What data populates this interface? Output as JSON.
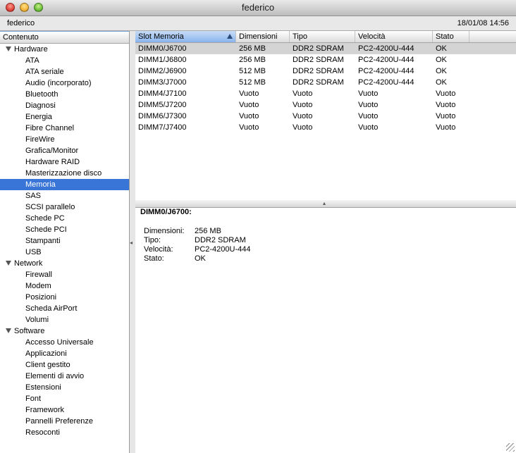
{
  "window": {
    "title": "federico"
  },
  "infobar": {
    "computer_name": "federico",
    "datetime": "18/01/08 14:56"
  },
  "sidebar": {
    "header": "Contenuto",
    "groups": [
      {
        "label": "Hardware",
        "items": [
          "ATA",
          "ATA seriale",
          "Audio (incorporato)",
          "Bluetooth",
          "Diagnosi",
          "Energia",
          "Fibre Channel",
          "FireWire",
          "Grafica/Monitor",
          "Hardware RAID",
          "Masterizzazione disco",
          "Memoria",
          "SAS",
          "SCSI parallelo",
          "Schede PC",
          "Schede PCI",
          "Stampanti",
          "USB"
        ]
      },
      {
        "label": "Network",
        "items": [
          "Firewall",
          "Modem",
          "Posizioni",
          "Scheda AirPort",
          "Volumi"
        ]
      },
      {
        "label": "Software",
        "items": [
          "Accesso Universale",
          "Applicazioni",
          "Client gestito",
          "Elementi di avvio",
          "Estensioni",
          "Font",
          "Framework",
          "Pannelli Preferenze",
          "Resoconti"
        ]
      }
    ],
    "selected": "Memoria"
  },
  "table": {
    "columns": [
      "Slot Memoria",
      "Dimensioni",
      "Tipo",
      "Velocità",
      "Stato",
      ""
    ],
    "rows": [
      [
        "DIMM0/J6700",
        "256 MB",
        "DDR2 SDRAM",
        "PC2-4200U-444",
        "OK"
      ],
      [
        "DIMM1/J6800",
        "256 MB",
        "DDR2 SDRAM",
        "PC2-4200U-444",
        "OK"
      ],
      [
        "DIMM2/J6900",
        "512 MB",
        "DDR2 SDRAM",
        "PC2-4200U-444",
        "OK"
      ],
      [
        "DIMM3/J7000",
        "512 MB",
        "DDR2 SDRAM",
        "PC2-4200U-444",
        "OK"
      ],
      [
        "DIMM4/J7100",
        "Vuoto",
        "Vuoto",
        "Vuoto",
        "Vuoto"
      ],
      [
        "DIMM5/J7200",
        "Vuoto",
        "Vuoto",
        "Vuoto",
        "Vuoto"
      ],
      [
        "DIMM6/J7300",
        "Vuoto",
        "Vuoto",
        "Vuoto",
        "Vuoto"
      ],
      [
        "DIMM7/J7400",
        "Vuoto",
        "Vuoto",
        "Vuoto",
        "Vuoto"
      ]
    ],
    "selected_row": 0
  },
  "detail": {
    "title": "DIMM0/J6700:",
    "fields": [
      {
        "key": "Dimensioni:",
        "value": "256 MB"
      },
      {
        "key": "Tipo:",
        "value": "DDR2 SDRAM"
      },
      {
        "key": "Velocità:",
        "value": "PC2-4200U-444"
      },
      {
        "key": "Stato:",
        "value": "OK"
      }
    ]
  },
  "icons": {
    "triangle": "disclosure-triangle-icon",
    "sort": "sort-ascending-icon",
    "splitter": "splitter-handle-icon",
    "resize": "resize-grip-icon"
  },
  "colors": {
    "selection": "#3875d7",
    "row_selected": "#d4d4d4",
    "sorted_header": "#8ab3ec"
  }
}
